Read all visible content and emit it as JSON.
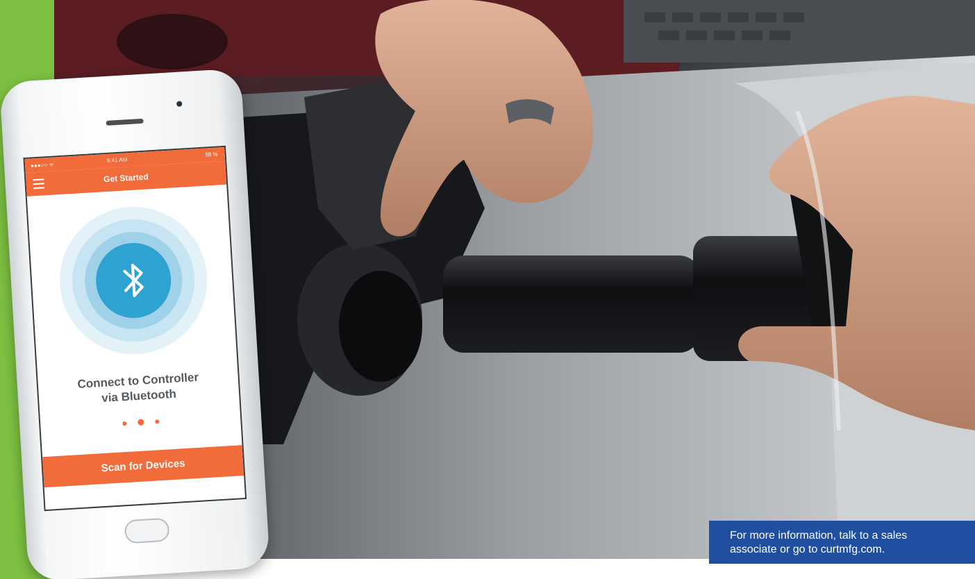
{
  "colors": {
    "brand_green": "#7dc142",
    "app_orange": "#f26b3a",
    "info_blue": "#1f4f9e"
  },
  "phone_app": {
    "status_time": "9:41 AM",
    "status_battery": "58 %",
    "header_title": "Get Started",
    "connect_text_line1": "Connect to Controller",
    "connect_text_line2": "via Bluetooth",
    "scan_button_label": "Scan for Devices",
    "icon": "bluetooth-icon"
  },
  "info": {
    "line1": "For more information, talk to a sales",
    "line2": "associate or go to curtmfg.com."
  }
}
